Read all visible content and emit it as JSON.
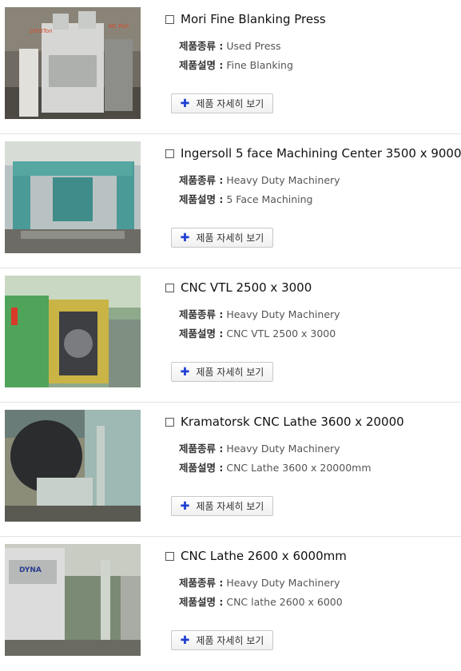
{
  "items": [
    {
      "title": "Mori Fine Blanking Press",
      "type_label": "제품종류 :",
      "type_value": "Used Press",
      "desc_label": "제품설명 :",
      "desc_value": "Fine Blanking",
      "button": "제품 자세히 보기",
      "image_marks": {
        "left": "1000Ton",
        "right": "NC Roll"
      }
    },
    {
      "title": "Ingersoll 5 face Machining Center 3500 x 9000",
      "type_label": "제품종류 :",
      "type_value": "Heavy Duty Machinery",
      "desc_label": "제품설명 :",
      "desc_value": "5 Face Machining",
      "button": "제품 자세히 보기"
    },
    {
      "title": "CNC VTL 2500 x 3000",
      "type_label": "제품종류 :",
      "type_value": "Heavy Duty Machinery",
      "desc_label": "제품설명 :",
      "desc_value": "CNC VTL 2500 x 3000",
      "button": "제품 자세히 보기"
    },
    {
      "title": "Kramatorsk CNC Lathe 3600 x 20000",
      "type_label": "제품종류 :",
      "type_value": "Heavy Duty Machinery",
      "desc_label": "제품설명 :",
      "desc_value": "CNC Lathe 3600 x 20000mm",
      "button": "제품 자세히 보기"
    },
    {
      "title": "CNC Lathe 2600 x 6000mm",
      "type_label": "제품종류 :",
      "type_value": "Heavy Duty Machinery",
      "desc_label": "제품설명 :",
      "desc_value": "CNC lathe 2600 x 6000",
      "button": "제품 자세히 보기",
      "image_marks": {
        "brand": "DYNA"
      }
    }
  ],
  "colors": {
    "plus_icon": "#1f3fd4",
    "divider": "#e3e3e3"
  }
}
